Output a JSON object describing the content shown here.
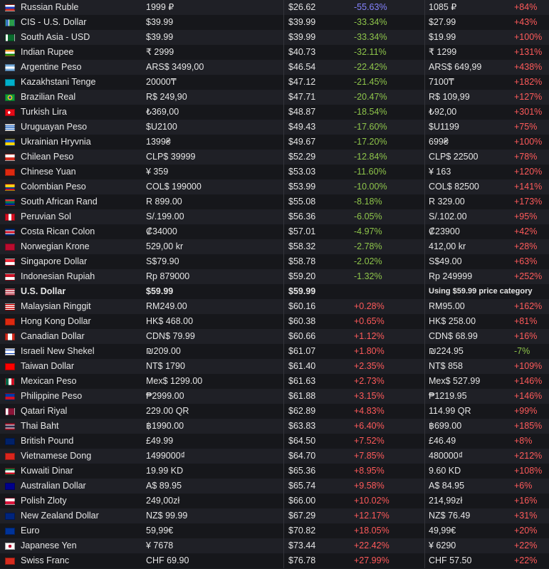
{
  "colors": {
    "negative": "#8ec44a",
    "positive": "#ff5a5a",
    "highlight": "#8583ff"
  },
  "usd_note": "Using $59.99 price category",
  "rows": [
    {
      "flag": "ru",
      "name": "Russian Ruble",
      "price": "1999 ₽",
      "usd": "$26.62",
      "diff": "-55.63%",
      "rec": "1085 ₽",
      "rdiff": "+84%",
      "diff_style": "blue"
    },
    {
      "flag": "cis",
      "name": "CIS - U.S. Dollar",
      "price": "$39.99",
      "usd": "$39.99",
      "diff": "-33.34%",
      "rec": "$27.99",
      "rdiff": "+43%"
    },
    {
      "flag": "pk",
      "name": "South Asia - USD",
      "price": "$39.99",
      "usd": "$39.99",
      "diff": "-33.34%",
      "rec": "$19.99",
      "rdiff": "+100%"
    },
    {
      "flag": "in",
      "name": "Indian Rupee",
      "price": "₹ 2999",
      "usd": "$40.73",
      "diff": "-32.11%",
      "rec": "₹ 1299",
      "rdiff": "+131%"
    },
    {
      "flag": "ar",
      "name": "Argentine Peso",
      "price": "ARS$ 3499,00",
      "usd": "$46.54",
      "diff": "-22.42%",
      "rec": "ARS$ 649,99",
      "rdiff": "+438%"
    },
    {
      "flag": "kz",
      "name": "Kazakhstani Tenge",
      "price": "20000₸",
      "usd": "$47.12",
      "diff": "-21.45%",
      "rec": "7100₸",
      "rdiff": "+182%"
    },
    {
      "flag": "br",
      "name": "Brazilian Real",
      "price": "R$ 249,90",
      "usd": "$47.71",
      "diff": "-20.47%",
      "rec": "R$ 109,99",
      "rdiff": "+127%"
    },
    {
      "flag": "tr",
      "name": "Turkish Lira",
      "price": "₺369,00",
      "usd": "$48.87",
      "diff": "-18.54%",
      "rec": "₺92,00",
      "rdiff": "+301%"
    },
    {
      "flag": "uy",
      "name": "Uruguayan Peso",
      "price": "$U2100",
      "usd": "$49.43",
      "diff": "-17.60%",
      "rec": "$U1199",
      "rdiff": "+75%"
    },
    {
      "flag": "ua",
      "name": "Ukrainian Hryvnia",
      "price": "1399₴",
      "usd": "$49.67",
      "diff": "-17.20%",
      "rec": "699₴",
      "rdiff": "+100%"
    },
    {
      "flag": "cl",
      "name": "Chilean Peso",
      "price": "CLP$ 39999",
      "usd": "$52.29",
      "diff": "-12.84%",
      "rec": "CLP$ 22500",
      "rdiff": "+78%"
    },
    {
      "flag": "cn",
      "name": "Chinese Yuan",
      "price": "¥ 359",
      "usd": "$53.03",
      "diff": "-11.60%",
      "rec": "¥ 163",
      "rdiff": "+120%"
    },
    {
      "flag": "co",
      "name": "Colombian Peso",
      "price": "COL$ 199000",
      "usd": "$53.99",
      "diff": "-10.00%",
      "rec": "COL$ 82500",
      "rdiff": "+141%"
    },
    {
      "flag": "za",
      "name": "South African Rand",
      "price": "R 899.00",
      "usd": "$55.08",
      "diff": "-8.18%",
      "rec": "R 329.00",
      "rdiff": "+173%"
    },
    {
      "flag": "pe",
      "name": "Peruvian Sol",
      "price": "S/.199.00",
      "usd": "$56.36",
      "diff": "-6.05%",
      "rec": "S/.102.00",
      "rdiff": "+95%"
    },
    {
      "flag": "cr",
      "name": "Costa Rican Colon",
      "price": "₡34000",
      "usd": "$57.01",
      "diff": "-4.97%",
      "rec": "₡23900",
      "rdiff": "+42%"
    },
    {
      "flag": "no",
      "name": "Norwegian Krone",
      "price": "529,00 kr",
      "usd": "$58.32",
      "diff": "-2.78%",
      "rec": "412,00 kr",
      "rdiff": "+28%"
    },
    {
      "flag": "sg",
      "name": "Singapore Dollar",
      "price": "S$79.90",
      "usd": "$58.78",
      "diff": "-2.02%",
      "rec": "S$49.00",
      "rdiff": "+63%"
    },
    {
      "flag": "id",
      "name": "Indonesian Rupiah",
      "price": "Rp 879000",
      "usd": "$59.20",
      "diff": "-1.32%",
      "rec": "Rp 249999",
      "rdiff": "+252%"
    },
    {
      "flag": "us",
      "name": "U.S. Dollar",
      "price": "$59.99",
      "usd": "$59.99",
      "diff": "",
      "rec": "",
      "rdiff": "",
      "is_base": true
    },
    {
      "flag": "my",
      "name": "Malaysian Ringgit",
      "price": "RM249.00",
      "usd": "$60.16",
      "diff": "+0.28%",
      "rec": "RM95.00",
      "rdiff": "+162%"
    },
    {
      "flag": "hk",
      "name": "Hong Kong Dollar",
      "price": "HK$ 468.00",
      "usd": "$60.38",
      "diff": "+0.65%",
      "rec": "HK$ 258.00",
      "rdiff": "+81%"
    },
    {
      "flag": "ca",
      "name": "Canadian Dollar",
      "price": "CDN$ 79.99",
      "usd": "$60.66",
      "diff": "+1.12%",
      "rec": "CDN$ 68.99",
      "rdiff": "+16%"
    },
    {
      "flag": "il",
      "name": "Israeli New Shekel",
      "price": "₪209.00",
      "usd": "$61.07",
      "diff": "+1.80%",
      "rec": "₪224.95",
      "rdiff": "-7%",
      "rdiff_neg": true
    },
    {
      "flag": "tw",
      "name": "Taiwan Dollar",
      "price": "NT$ 1790",
      "usd": "$61.40",
      "diff": "+2.35%",
      "rec": "NT$ 858",
      "rdiff": "+109%"
    },
    {
      "flag": "mx",
      "name": "Mexican Peso",
      "price": "Mex$ 1299.00",
      "usd": "$61.63",
      "diff": "+2.73%",
      "rec": "Mex$ 527.99",
      "rdiff": "+146%"
    },
    {
      "flag": "ph",
      "name": "Philippine Peso",
      "price": "₱2999.00",
      "usd": "$61.88",
      "diff": "+3.15%",
      "rec": "₱1219.95",
      "rdiff": "+146%"
    },
    {
      "flag": "qa",
      "name": "Qatari Riyal",
      "price": "229.00 QR",
      "usd": "$62.89",
      "diff": "+4.83%",
      "rec": "114.99 QR",
      "rdiff": "+99%"
    },
    {
      "flag": "th",
      "name": "Thai Baht",
      "price": "฿1990.00",
      "usd": "$63.83",
      "diff": "+6.40%",
      "rec": "฿699.00",
      "rdiff": "+185%"
    },
    {
      "flag": "gb",
      "name": "British Pound",
      "price": "£49.99",
      "usd": "$64.50",
      "diff": "+7.52%",
      "rec": "£46.49",
      "rdiff": "+8%"
    },
    {
      "flag": "vn",
      "name": "Vietnamese Dong",
      "price": "1499000₫",
      "usd": "$64.70",
      "diff": "+7.85%",
      "rec": "480000₫",
      "rdiff": "+212%"
    },
    {
      "flag": "kw",
      "name": "Kuwaiti Dinar",
      "price": "19.99 KD",
      "usd": "$65.36",
      "diff": "+8.95%",
      "rec": "9.60 KD",
      "rdiff": "+108%"
    },
    {
      "flag": "au",
      "name": "Australian Dollar",
      "price": "A$ 89.95",
      "usd": "$65.74",
      "diff": "+9.58%",
      "rec": "A$ 84.95",
      "rdiff": "+6%"
    },
    {
      "flag": "pl",
      "name": "Polish Zloty",
      "price": "249,00zł",
      "usd": "$66.00",
      "diff": "+10.02%",
      "rec": "214,99zł",
      "rdiff": "+16%"
    },
    {
      "flag": "nz",
      "name": "New Zealand Dollar",
      "price": "NZ$ 99.99",
      "usd": "$67.29",
      "diff": "+12.17%",
      "rec": "NZ$ 76.49",
      "rdiff": "+31%"
    },
    {
      "flag": "eu",
      "name": "Euro",
      "price": "59,99€",
      "usd": "$70.82",
      "diff": "+18.05%",
      "rec": "49,99€",
      "rdiff": "+20%"
    },
    {
      "flag": "jp",
      "name": "Japanese Yen",
      "price": "¥ 7678",
      "usd": "$73.44",
      "diff": "+22.42%",
      "rec": "¥ 6290",
      "rdiff": "+22%"
    },
    {
      "flag": "ch",
      "name": "Swiss Franc",
      "price": "CHF 69.90",
      "usd": "$76.78",
      "diff": "+27.99%",
      "rec": "CHF 57.50",
      "rdiff": "+22%"
    }
  ]
}
